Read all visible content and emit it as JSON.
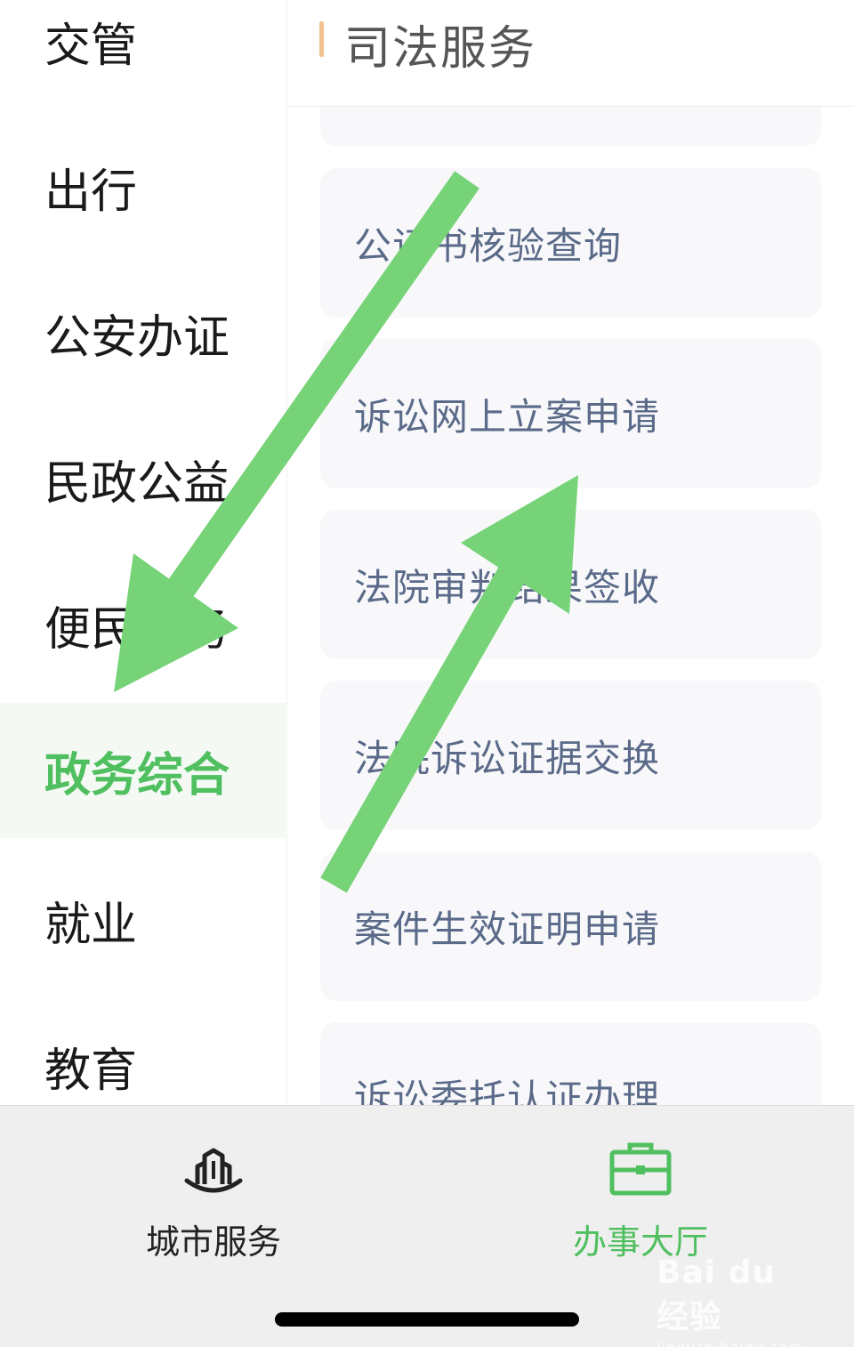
{
  "sidebar": {
    "items": [
      {
        "label": "交管",
        "active": false
      },
      {
        "label": "出行",
        "active": false
      },
      {
        "label": "公安办证",
        "active": false
      },
      {
        "label": "民政公益",
        "active": false
      },
      {
        "label": "便民服务",
        "active": false
      },
      {
        "label": "政务综合",
        "active": true
      },
      {
        "label": "就业",
        "active": false
      },
      {
        "label": "教育",
        "active": false
      }
    ]
  },
  "main": {
    "section_title": "司法服务",
    "services": [
      {
        "label": "公证书核验查询"
      },
      {
        "label": "诉讼网上立案申请"
      },
      {
        "label": "法院审判结果签收"
      },
      {
        "label": "法院诉讼证据交换"
      },
      {
        "label": "案件生效证明申请"
      },
      {
        "label": "诉讼委托认证办理"
      }
    ]
  },
  "tabbar": {
    "tabs": [
      {
        "label": "城市服务",
        "icon": "city-building-icon",
        "active": false
      },
      {
        "label": "办事大厅",
        "icon": "briefcase-icon",
        "active": true
      }
    ]
  },
  "watermark": {
    "main": "Bai du 经验",
    "sub": "jingyan.baidu.com"
  },
  "colors": {
    "accent_green": "#4fbf5f",
    "arrow_green": "#77d377",
    "section_bar": "#f2c48d",
    "service_text": "#5a6a88",
    "active_bg": "#f4f9f4"
  }
}
